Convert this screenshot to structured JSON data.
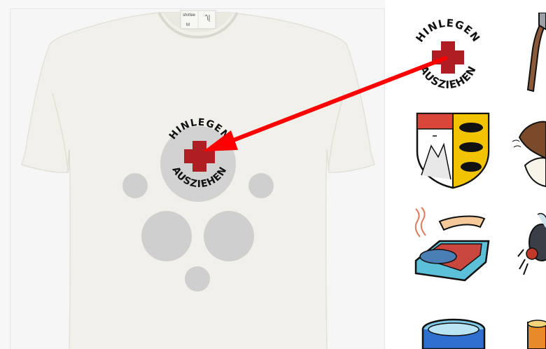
{
  "design": {
    "line1": "HINLEGEN",
    "line2": "AUSZIEHEN"
  },
  "shirt": {
    "color": "#f1f0ea",
    "collar_tag_text": "shirtee",
    "collar_tag_size": "M"
  },
  "zones": {
    "placeholder_color": "#cfcfcf",
    "chest_selected": true
  },
  "arrow": {
    "color": "#ff0000"
  },
  "colors": {
    "cross_red": "#b01e23",
    "text_black": "#111111"
  },
  "gallery": {
    "items": [
      {
        "name": "hinlegen-ausziehen"
      },
      {
        "name": "axe"
      },
      {
        "name": "coat-of-arms"
      },
      {
        "name": "coconut"
      },
      {
        "name": "sardine-can"
      },
      {
        "name": "fly"
      },
      {
        "name": "pool"
      },
      {
        "name": "drink"
      }
    ]
  }
}
